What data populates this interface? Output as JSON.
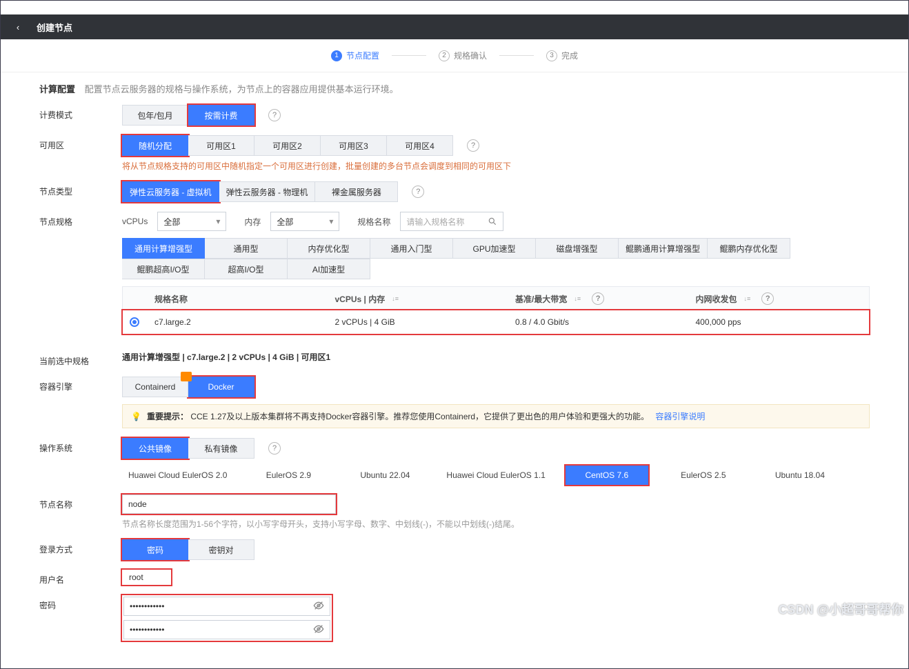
{
  "header": {
    "title": "创建节点"
  },
  "steps": {
    "s1": "节点配置",
    "s2": "规格确认",
    "s3": "完成"
  },
  "compute": {
    "title": "计算配置",
    "desc": "配置节点云服务器的规格与操作系统，为节点上的容器应用提供基本运行环境。"
  },
  "billing": {
    "label": "计费模式",
    "opts": [
      "包年/包月",
      "按需计费"
    ]
  },
  "az": {
    "label": "可用区",
    "opts": [
      "随机分配",
      "可用区1",
      "可用区2",
      "可用区3",
      "可用区4"
    ],
    "note": "将从节点规格支持的可用区中随机指定一个可用区进行创建，批量创建的多台节点会调度到相同的可用区下"
  },
  "nodeType": {
    "label": "节点类型",
    "opts": [
      "弹性云服务器 - 虚拟机",
      "弹性云服务器 - 物理机",
      "裸金属服务器"
    ]
  },
  "spec": {
    "label": "节点规格",
    "vcpu_label": "vCPUs",
    "vcpu_value": "全部",
    "mem_label": "内存",
    "mem_value": "全部",
    "name_label": "规格名称",
    "search_placeholder": "请输入规格名称",
    "cats": [
      "通用计算增强型",
      "通用型",
      "内存优化型",
      "通用入门型",
      "GPU加速型",
      "磁盘增强型",
      "鲲鹏通用计算增强型",
      "鲲鹏内存优化型",
      "鲲鹏超高I/O型",
      "超高I/O型",
      "AI加速型"
    ],
    "table": {
      "h1": "规格名称",
      "h2": "vCPUs | 内存",
      "h3": "基准/最大带宽",
      "h4": "内网收发包",
      "row": {
        "name": "c7.large.2",
        "cpu": "2 vCPUs | 4 GiB",
        "bw": "0.8 / 4.0 Gbit/s",
        "pps": "400,000 pps"
      }
    }
  },
  "selected": {
    "label": "当前选中规格",
    "value": "通用计算增强型 | c7.large.2 | 2 vCPUs | 4 GiB | 可用区1"
  },
  "engine": {
    "label": "容器引擎",
    "opts": [
      "Containerd",
      "Docker"
    ],
    "tip_prefix": "重要提示：",
    "tip": "CCE 1.27及以上版本集群将不再支持Docker容器引擎。推荐您使用Containerd，它提供了更出色的用户体验和更强大的功能。",
    "tip_link": "容器引擎说明"
  },
  "os": {
    "label": "操作系统",
    "tabs": [
      "公共镜像",
      "私有镜像"
    ],
    "list": [
      "Huawei Cloud EulerOS 2.0",
      "EulerOS 2.9",
      "Ubuntu 22.04",
      "Huawei Cloud EulerOS 1.1",
      "CentOS 7.6",
      "EulerOS 2.5",
      "Ubuntu 18.04"
    ]
  },
  "nodeName": {
    "label": "节点名称",
    "value": "node",
    "hint": "节点名称长度范围为1-56个字符，以小写字母开头，支持小写字母、数字、中划线(-)，不能以中划线(-)结尾。"
  },
  "login": {
    "label": "登录方式",
    "opts": [
      "密码",
      "密钥对"
    ]
  },
  "username": {
    "label": "用户名",
    "value": "root"
  },
  "password": {
    "label": "密码",
    "mask": "••••••••••••"
  },
  "watermark": "CSDN @小超哥哥帮你"
}
